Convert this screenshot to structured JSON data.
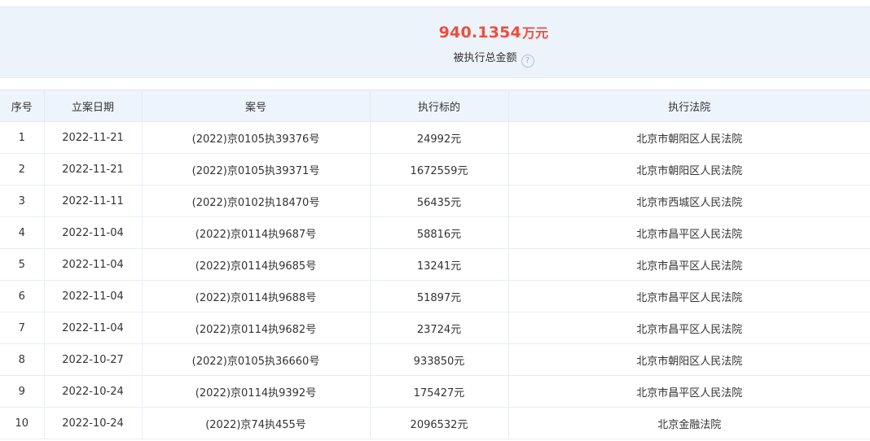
{
  "summary": {
    "amount": "940.1354",
    "unit": "万元",
    "caption": "被执行总金额",
    "help_glyph": "?"
  },
  "table": {
    "columns": [
      "序号",
      "立案日期",
      "案号",
      "执行标的",
      "执行法院"
    ],
    "rows": [
      [
        "1",
        "2022-11-21",
        "(2022)京0105执39376号",
        "24992元",
        "北京市朝阳区人民法院"
      ],
      [
        "2",
        "2022-11-21",
        "(2022)京0105执39371号",
        "1672559元",
        "北京市朝阳区人民法院"
      ],
      [
        "3",
        "2022-11-11",
        "(2022)京0102执18470号",
        "56435元",
        "北京市西城区人民法院"
      ],
      [
        "4",
        "2022-11-04",
        "(2022)京0114执9687号",
        "58816元",
        "北京市昌平区人民法院"
      ],
      [
        "5",
        "2022-11-04",
        "(2022)京0114执9685号",
        "13241元",
        "北京市昌平区人民法院"
      ],
      [
        "6",
        "2022-11-04",
        "(2022)京0114执9688号",
        "51897元",
        "北京市昌平区人民法院"
      ],
      [
        "7",
        "2022-11-04",
        "(2022)京0114执9682号",
        "23724元",
        "北京市昌平区人民法院"
      ],
      [
        "8",
        "2022-10-27",
        "(2022)京0105执36660号",
        "933850元",
        "北京市朝阳区人民法院"
      ],
      [
        "9",
        "2022-10-24",
        "(2022)京0114执9392号",
        "175427元",
        "北京市昌平区人民法院"
      ],
      [
        "10",
        "2022-10-24",
        "(2022)京74执455号",
        "2096532元",
        "北京金融法院"
      ]
    ]
  }
}
